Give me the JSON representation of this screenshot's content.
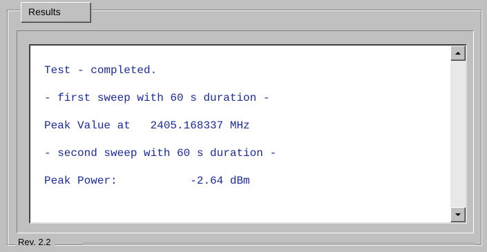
{
  "group": {
    "title": "Results",
    "revision": "Rev. 2.2"
  },
  "output": {
    "lines": [
      "Test - completed.",
      "- first sweep with 60 s duration -",
      "Peak Value at   2405.168337 MHz",
      "- second sweep with 60 s duration -",
      "Peak Power:           -2.64 dBm"
    ]
  },
  "scrollbar": {
    "up_icon": "scroll-up-arrow-icon",
    "down_icon": "scroll-down-arrow-icon"
  },
  "colors": {
    "text": "#1a2a9a",
    "background": "#c0c0c0",
    "output_background": "#ffffff"
  }
}
